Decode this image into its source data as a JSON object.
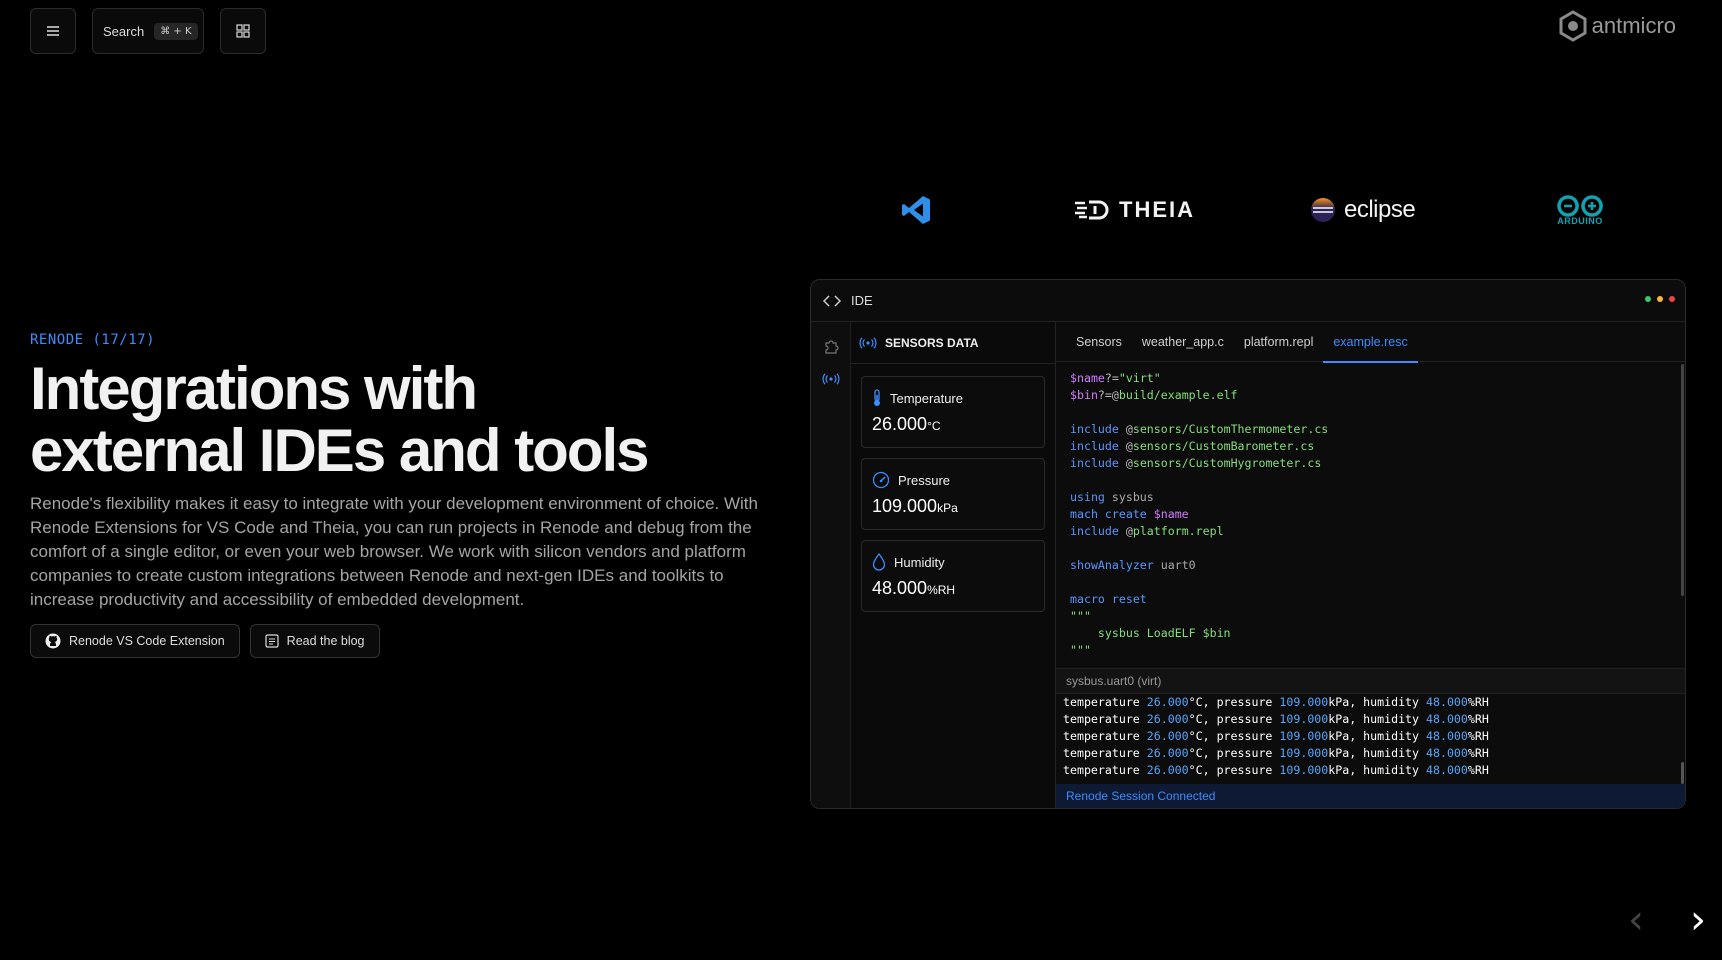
{
  "topbar": {
    "search_label": "Search",
    "search_shortcut": "⌘ + K",
    "logo_text": "antmicro"
  },
  "intro": {
    "kicker": "RENODE (17/17)",
    "headline_line1": "Integrations with",
    "headline_line2": "external IDEs and tools",
    "lead": "Renode's flexibility makes it easy to integrate with your development environment of choice. With Renode Extensions for VS Code and Theia, you can run projects in Renode and debug from the comfort of a single editor, or even your web browser. We work with silicon vendors and platform companies to create custom integrations between Renode and next-gen IDEs and toolkits to increase productivity and accessibility of embedded development.",
    "cta_vscode": "Renode VS Code Extension",
    "cta_blog": "Read the blog"
  },
  "ide_logos": {
    "theia": "THEIA",
    "eclipse": "eclipse",
    "arduino": "ARDUINO"
  },
  "ide": {
    "title": "IDE",
    "window_dots": [
      "#3ec46d",
      "#f6b73c",
      "#ef4444"
    ],
    "sensors": {
      "header": "SENSORS DATA",
      "temperature": {
        "label": "Temperature",
        "value": "26.000",
        "unit": "°C"
      },
      "pressure": {
        "label": "Pressure",
        "value": "109.000",
        "unit": "kPa"
      },
      "humidity": {
        "label": "Humidity",
        "value": "48.000",
        "unit": "%RH"
      }
    },
    "tabs": [
      "Sensors",
      "weather_app.c",
      "platform.repl",
      "example.resc"
    ],
    "active_tab": "example.resc",
    "console_title": "sysbus.uart0 (virt)",
    "console_line": {
      "t_label": "temperature ",
      "t_value": "26.000",
      "t_unit": "°C, pressure ",
      "p_value": "109.000",
      "p_unit": "kPa, humidity ",
      "h_value": "48.000",
      "h_unit": "%RH"
    },
    "status": "Renode Session Connected"
  },
  "nav": {
    "prev": "‹",
    "next": "›"
  },
  "colors": {
    "accent": "#3f8cff",
    "background": "#000000"
  }
}
